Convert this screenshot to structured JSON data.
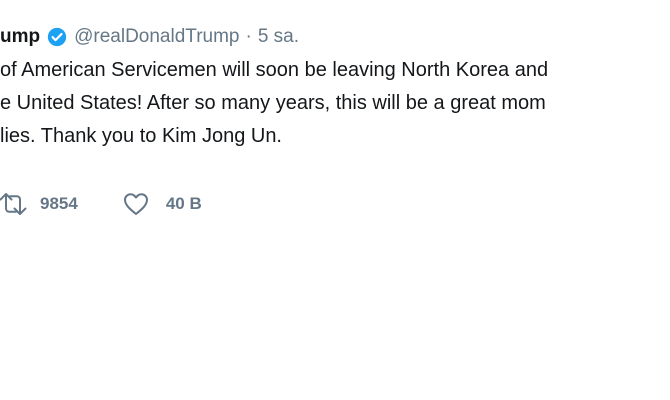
{
  "tweet": {
    "author_name": "ump",
    "handle": "@realDonaldTrump",
    "separator": "·",
    "time": "5 sa.",
    "text_lines": [
      "of American Servicemen will soon be leaving North Korea and",
      "e United States! After so many years, this will be a great mom",
      "lies. Thank you to Kim Jong Un."
    ],
    "retweets": "9854",
    "likes": "40 B"
  },
  "icons": {
    "verified": "verified-badge-icon",
    "retweet": "retweet-icon",
    "like": "heart-icon"
  },
  "colors": {
    "verified_blue": "#1da1f2",
    "text": "#14171a",
    "secondary_text": "#657786",
    "background": "#ffffff"
  }
}
